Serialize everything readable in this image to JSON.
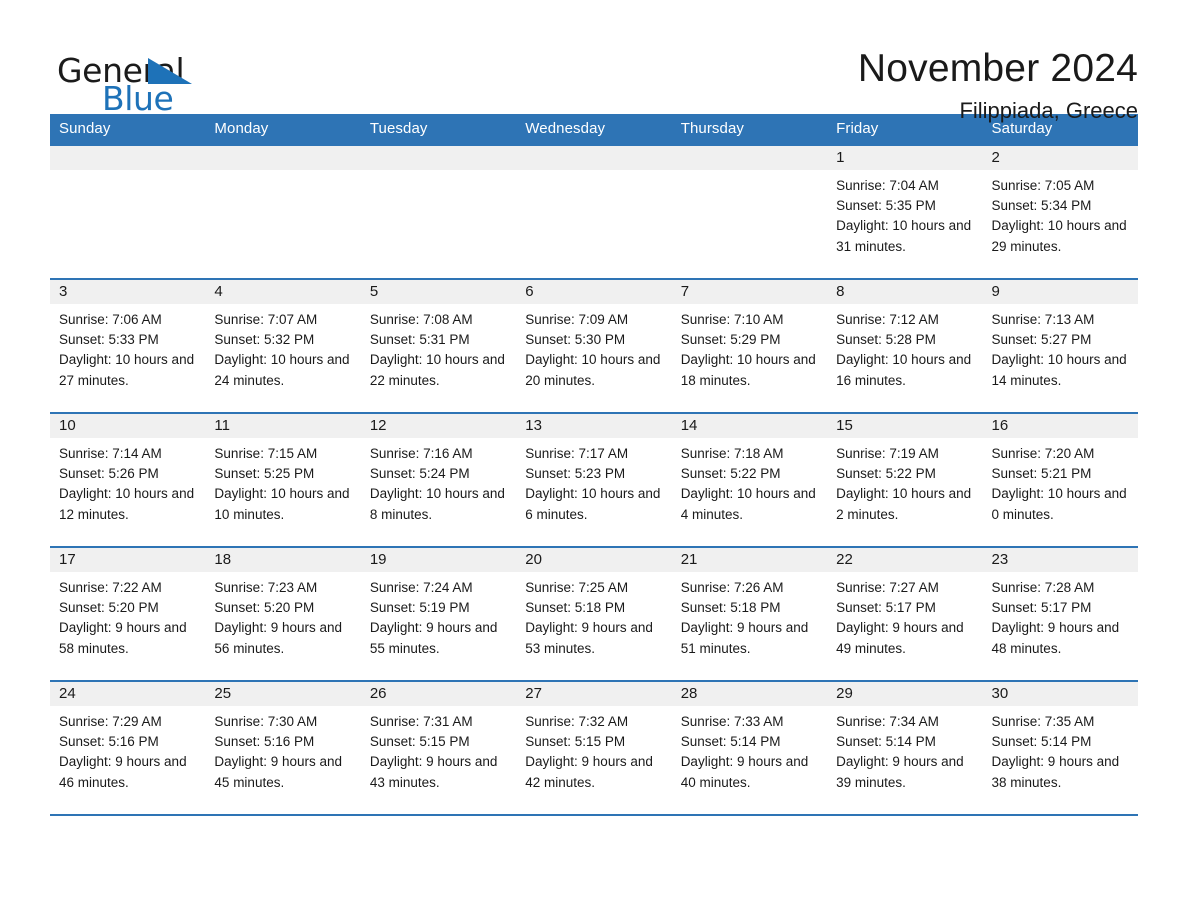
{
  "brand": {
    "name_dark": "General",
    "name_light": "Blue",
    "flag_icon": "triangle-flag-icon",
    "accent_color": "#1e72b8"
  },
  "header": {
    "title": "November 2024",
    "location": "Filippiada, Greece"
  },
  "calendar": {
    "header_bg": "#2e74b5",
    "daynum_bg": "#f0f0f0",
    "weekday_headers": [
      "Sunday",
      "Monday",
      "Tuesday",
      "Wednesday",
      "Thursday",
      "Friday",
      "Saturday"
    ],
    "weeks": [
      [
        {
          "day": "",
          "sunrise": "",
          "sunset": "",
          "daylight": ""
        },
        {
          "day": "",
          "sunrise": "",
          "sunset": "",
          "daylight": ""
        },
        {
          "day": "",
          "sunrise": "",
          "sunset": "",
          "daylight": ""
        },
        {
          "day": "",
          "sunrise": "",
          "sunset": "",
          "daylight": ""
        },
        {
          "day": "",
          "sunrise": "",
          "sunset": "",
          "daylight": ""
        },
        {
          "day": "1",
          "sunrise": "Sunrise: 7:04 AM",
          "sunset": "Sunset: 5:35 PM",
          "daylight": "Daylight: 10 hours and 31 minutes."
        },
        {
          "day": "2",
          "sunrise": "Sunrise: 7:05 AM",
          "sunset": "Sunset: 5:34 PM",
          "daylight": "Daylight: 10 hours and 29 minutes."
        }
      ],
      [
        {
          "day": "3",
          "sunrise": "Sunrise: 7:06 AM",
          "sunset": "Sunset: 5:33 PM",
          "daylight": "Daylight: 10 hours and 27 minutes."
        },
        {
          "day": "4",
          "sunrise": "Sunrise: 7:07 AM",
          "sunset": "Sunset: 5:32 PM",
          "daylight": "Daylight: 10 hours and 24 minutes."
        },
        {
          "day": "5",
          "sunrise": "Sunrise: 7:08 AM",
          "sunset": "Sunset: 5:31 PM",
          "daylight": "Daylight: 10 hours and 22 minutes."
        },
        {
          "day": "6",
          "sunrise": "Sunrise: 7:09 AM",
          "sunset": "Sunset: 5:30 PM",
          "daylight": "Daylight: 10 hours and 20 minutes."
        },
        {
          "day": "7",
          "sunrise": "Sunrise: 7:10 AM",
          "sunset": "Sunset: 5:29 PM",
          "daylight": "Daylight: 10 hours and 18 minutes."
        },
        {
          "day": "8",
          "sunrise": "Sunrise: 7:12 AM",
          "sunset": "Sunset: 5:28 PM",
          "daylight": "Daylight: 10 hours and 16 minutes."
        },
        {
          "day": "9",
          "sunrise": "Sunrise: 7:13 AM",
          "sunset": "Sunset: 5:27 PM",
          "daylight": "Daylight: 10 hours and 14 minutes."
        }
      ],
      [
        {
          "day": "10",
          "sunrise": "Sunrise: 7:14 AM",
          "sunset": "Sunset: 5:26 PM",
          "daylight": "Daylight: 10 hours and 12 minutes."
        },
        {
          "day": "11",
          "sunrise": "Sunrise: 7:15 AM",
          "sunset": "Sunset: 5:25 PM",
          "daylight": "Daylight: 10 hours and 10 minutes."
        },
        {
          "day": "12",
          "sunrise": "Sunrise: 7:16 AM",
          "sunset": "Sunset: 5:24 PM",
          "daylight": "Daylight: 10 hours and 8 minutes."
        },
        {
          "day": "13",
          "sunrise": "Sunrise: 7:17 AM",
          "sunset": "Sunset: 5:23 PM",
          "daylight": "Daylight: 10 hours and 6 minutes."
        },
        {
          "day": "14",
          "sunrise": "Sunrise: 7:18 AM",
          "sunset": "Sunset: 5:22 PM",
          "daylight": "Daylight: 10 hours and 4 minutes."
        },
        {
          "day": "15",
          "sunrise": "Sunrise: 7:19 AM",
          "sunset": "Sunset: 5:22 PM",
          "daylight": "Daylight: 10 hours and 2 minutes."
        },
        {
          "day": "16",
          "sunrise": "Sunrise: 7:20 AM",
          "sunset": "Sunset: 5:21 PM",
          "daylight": "Daylight: 10 hours and 0 minutes."
        }
      ],
      [
        {
          "day": "17",
          "sunrise": "Sunrise: 7:22 AM",
          "sunset": "Sunset: 5:20 PM",
          "daylight": "Daylight: 9 hours and 58 minutes."
        },
        {
          "day": "18",
          "sunrise": "Sunrise: 7:23 AM",
          "sunset": "Sunset: 5:20 PM",
          "daylight": "Daylight: 9 hours and 56 minutes."
        },
        {
          "day": "19",
          "sunrise": "Sunrise: 7:24 AM",
          "sunset": "Sunset: 5:19 PM",
          "daylight": "Daylight: 9 hours and 55 minutes."
        },
        {
          "day": "20",
          "sunrise": "Sunrise: 7:25 AM",
          "sunset": "Sunset: 5:18 PM",
          "daylight": "Daylight: 9 hours and 53 minutes."
        },
        {
          "day": "21",
          "sunrise": "Sunrise: 7:26 AM",
          "sunset": "Sunset: 5:18 PM",
          "daylight": "Daylight: 9 hours and 51 minutes."
        },
        {
          "day": "22",
          "sunrise": "Sunrise: 7:27 AM",
          "sunset": "Sunset: 5:17 PM",
          "daylight": "Daylight: 9 hours and 49 minutes."
        },
        {
          "day": "23",
          "sunrise": "Sunrise: 7:28 AM",
          "sunset": "Sunset: 5:17 PM",
          "daylight": "Daylight: 9 hours and 48 minutes."
        }
      ],
      [
        {
          "day": "24",
          "sunrise": "Sunrise: 7:29 AM",
          "sunset": "Sunset: 5:16 PM",
          "daylight": "Daylight: 9 hours and 46 minutes."
        },
        {
          "day": "25",
          "sunrise": "Sunrise: 7:30 AM",
          "sunset": "Sunset: 5:16 PM",
          "daylight": "Daylight: 9 hours and 45 minutes."
        },
        {
          "day": "26",
          "sunrise": "Sunrise: 7:31 AM",
          "sunset": "Sunset: 5:15 PM",
          "daylight": "Daylight: 9 hours and 43 minutes."
        },
        {
          "day": "27",
          "sunrise": "Sunrise: 7:32 AM",
          "sunset": "Sunset: 5:15 PM",
          "daylight": "Daylight: 9 hours and 42 minutes."
        },
        {
          "day": "28",
          "sunrise": "Sunrise: 7:33 AM",
          "sunset": "Sunset: 5:14 PM",
          "daylight": "Daylight: 9 hours and 40 minutes."
        },
        {
          "day": "29",
          "sunrise": "Sunrise: 7:34 AM",
          "sunset": "Sunset: 5:14 PM",
          "daylight": "Daylight: 9 hours and 39 minutes."
        },
        {
          "day": "30",
          "sunrise": "Sunrise: 7:35 AM",
          "sunset": "Sunset: 5:14 PM",
          "daylight": "Daylight: 9 hours and 38 minutes."
        }
      ]
    ]
  }
}
